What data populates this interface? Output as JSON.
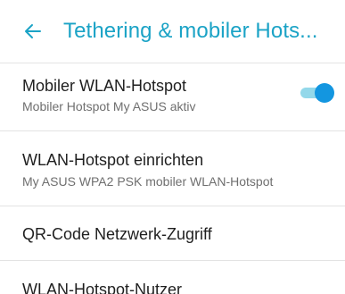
{
  "appbar": {
    "back_icon": "arrow-left-icon",
    "title": "Tethering & mobiler Hots..."
  },
  "colors": {
    "accent": "#1ba3c6",
    "toggle_knob": "#1396e0",
    "toggle_track": "#93d8ea"
  },
  "settings": {
    "hotspot": {
      "title": "Mobiler WLAN-Hotspot",
      "summary": "Mobiler Hotspot My ASUS aktiv",
      "enabled": true
    },
    "setup": {
      "title": "WLAN-Hotspot einrichten",
      "summary": "My ASUS WPA2 PSK mobiler WLAN-Hotspot"
    },
    "qr": {
      "title": "QR-Code Netzwerk-Zugriff"
    },
    "users": {
      "title": "WLAN-Hotspot-Nutzer"
    }
  }
}
